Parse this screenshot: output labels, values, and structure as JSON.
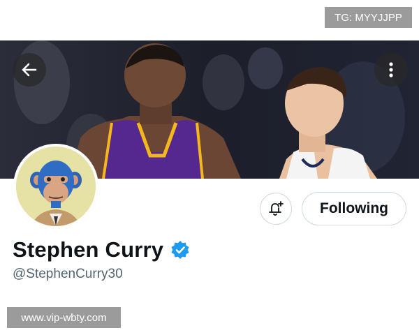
{
  "watermarks": {
    "top": "TG: MYYJJPP",
    "bottom": "www.vip-wbty.com"
  },
  "header": {
    "back_icon": "arrow-left-icon",
    "more_icon": "more-vertical-icon"
  },
  "profile": {
    "display_name": "Stephen Curry",
    "handle": "@StephenCurry30",
    "verified": true,
    "follow_label": "Following",
    "notify_icon": "bell-plus-icon"
  },
  "colors": {
    "verified_blue": "#1d9bf0",
    "lakers_purple": "#55288f",
    "lakers_gold": "#f5b81c",
    "avatar_bg": "#e6e1a4"
  }
}
